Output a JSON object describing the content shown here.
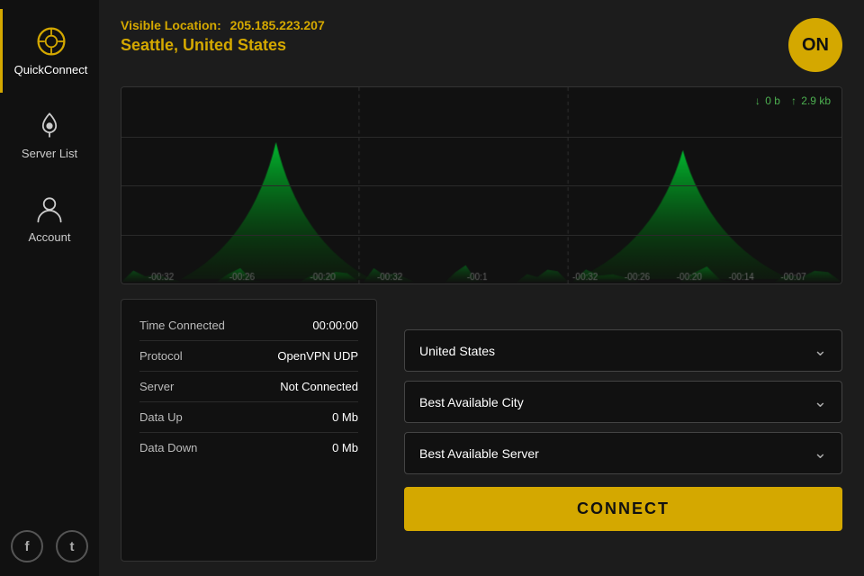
{
  "sidebar": {
    "items": [
      {
        "id": "quickconnect",
        "label": "QuickConnect",
        "active": true
      },
      {
        "id": "serverlist",
        "label": "Server List",
        "active": false
      },
      {
        "id": "account",
        "label": "Account",
        "active": false
      }
    ]
  },
  "topbar": {
    "visible_location_label": "Visible Location:",
    "ip_address": "205.185.223.207",
    "city": "Seattle, United States",
    "on_button_label": "ON"
  },
  "chart": {
    "download_label": "0 b",
    "upload_label": "2.9 kb",
    "down_arrow": "↓",
    "up_arrow": "↑"
  },
  "connection_info": {
    "rows": [
      {
        "label": "Time Connected",
        "value": "00:00:00"
      },
      {
        "label": "Protocol",
        "value": "OpenVPN UDP"
      },
      {
        "label": "Server",
        "value": "Not Connected"
      },
      {
        "label": "Data Up",
        "value": "0 Mb"
      },
      {
        "label": "Data Down",
        "value": "0 Mb"
      }
    ]
  },
  "controls": {
    "country_label": "United States",
    "city_label": "Best Available City",
    "server_label": "Best Available Server",
    "connect_button": "CONNECT"
  },
  "social": {
    "facebook": "f",
    "twitter": "t"
  }
}
